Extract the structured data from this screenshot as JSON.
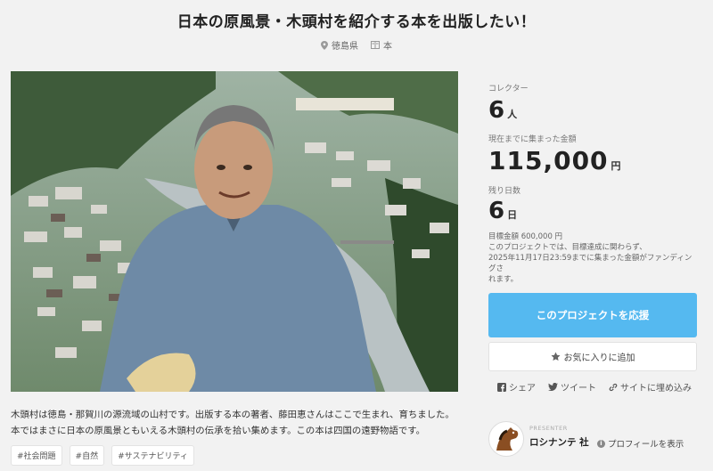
{
  "page": {
    "title": "日本の原風景・木頭村を紹介する本を出版したい！",
    "location": "徳島県",
    "category": "本"
  },
  "stats": {
    "collectors_label": "コレクター",
    "collectors_value": "6",
    "collectors_unit": "人",
    "amount_label": "現在までに集まった金額",
    "amount_value": "115,000",
    "amount_unit": "円",
    "days_label": "残り日数",
    "days_value": "6",
    "days_unit": "日",
    "goal": "目標金額 600,000 円",
    "note_line1": "このプロジェクトでは、目標達成に関わらず、",
    "note_line2": "2025年11月17日23:59までに集まった金額がファンディングさ",
    "note_line3": "れます。"
  },
  "actions": {
    "support_label": "このプロジェクトを応援",
    "favorite_label": "お気に入りに追加",
    "share_label": "シェア",
    "tweet_label": "ツイート",
    "embed_label": "サイトに埋め込み"
  },
  "description": {
    "line1": "木頭村は徳島・那賀川の源流域の山村です。出版する本の著者、藤田恵さんはここで生まれ、育ちました。",
    "line2": "本ではまさに日本の原風景ともいえる木頭村の伝承を拾い集めます。この本は四国の遠野物語です。"
  },
  "tags": [
    "#社会問題",
    "#自然",
    "#サステナビリティ"
  ],
  "presenter": {
    "label": "PRESENTER",
    "name": "ロシナンテ 社",
    "profile_link": "プロフィールを表示"
  },
  "colors": {
    "accent": "#55b9f0",
    "background": "#f2f2f2"
  },
  "icons": {
    "location": "map-pin-icon",
    "category": "book-icon",
    "favorite": "star-icon",
    "share": "facebook-icon",
    "tweet": "twitter-icon",
    "embed": "link-icon",
    "info": "info-icon"
  }
}
